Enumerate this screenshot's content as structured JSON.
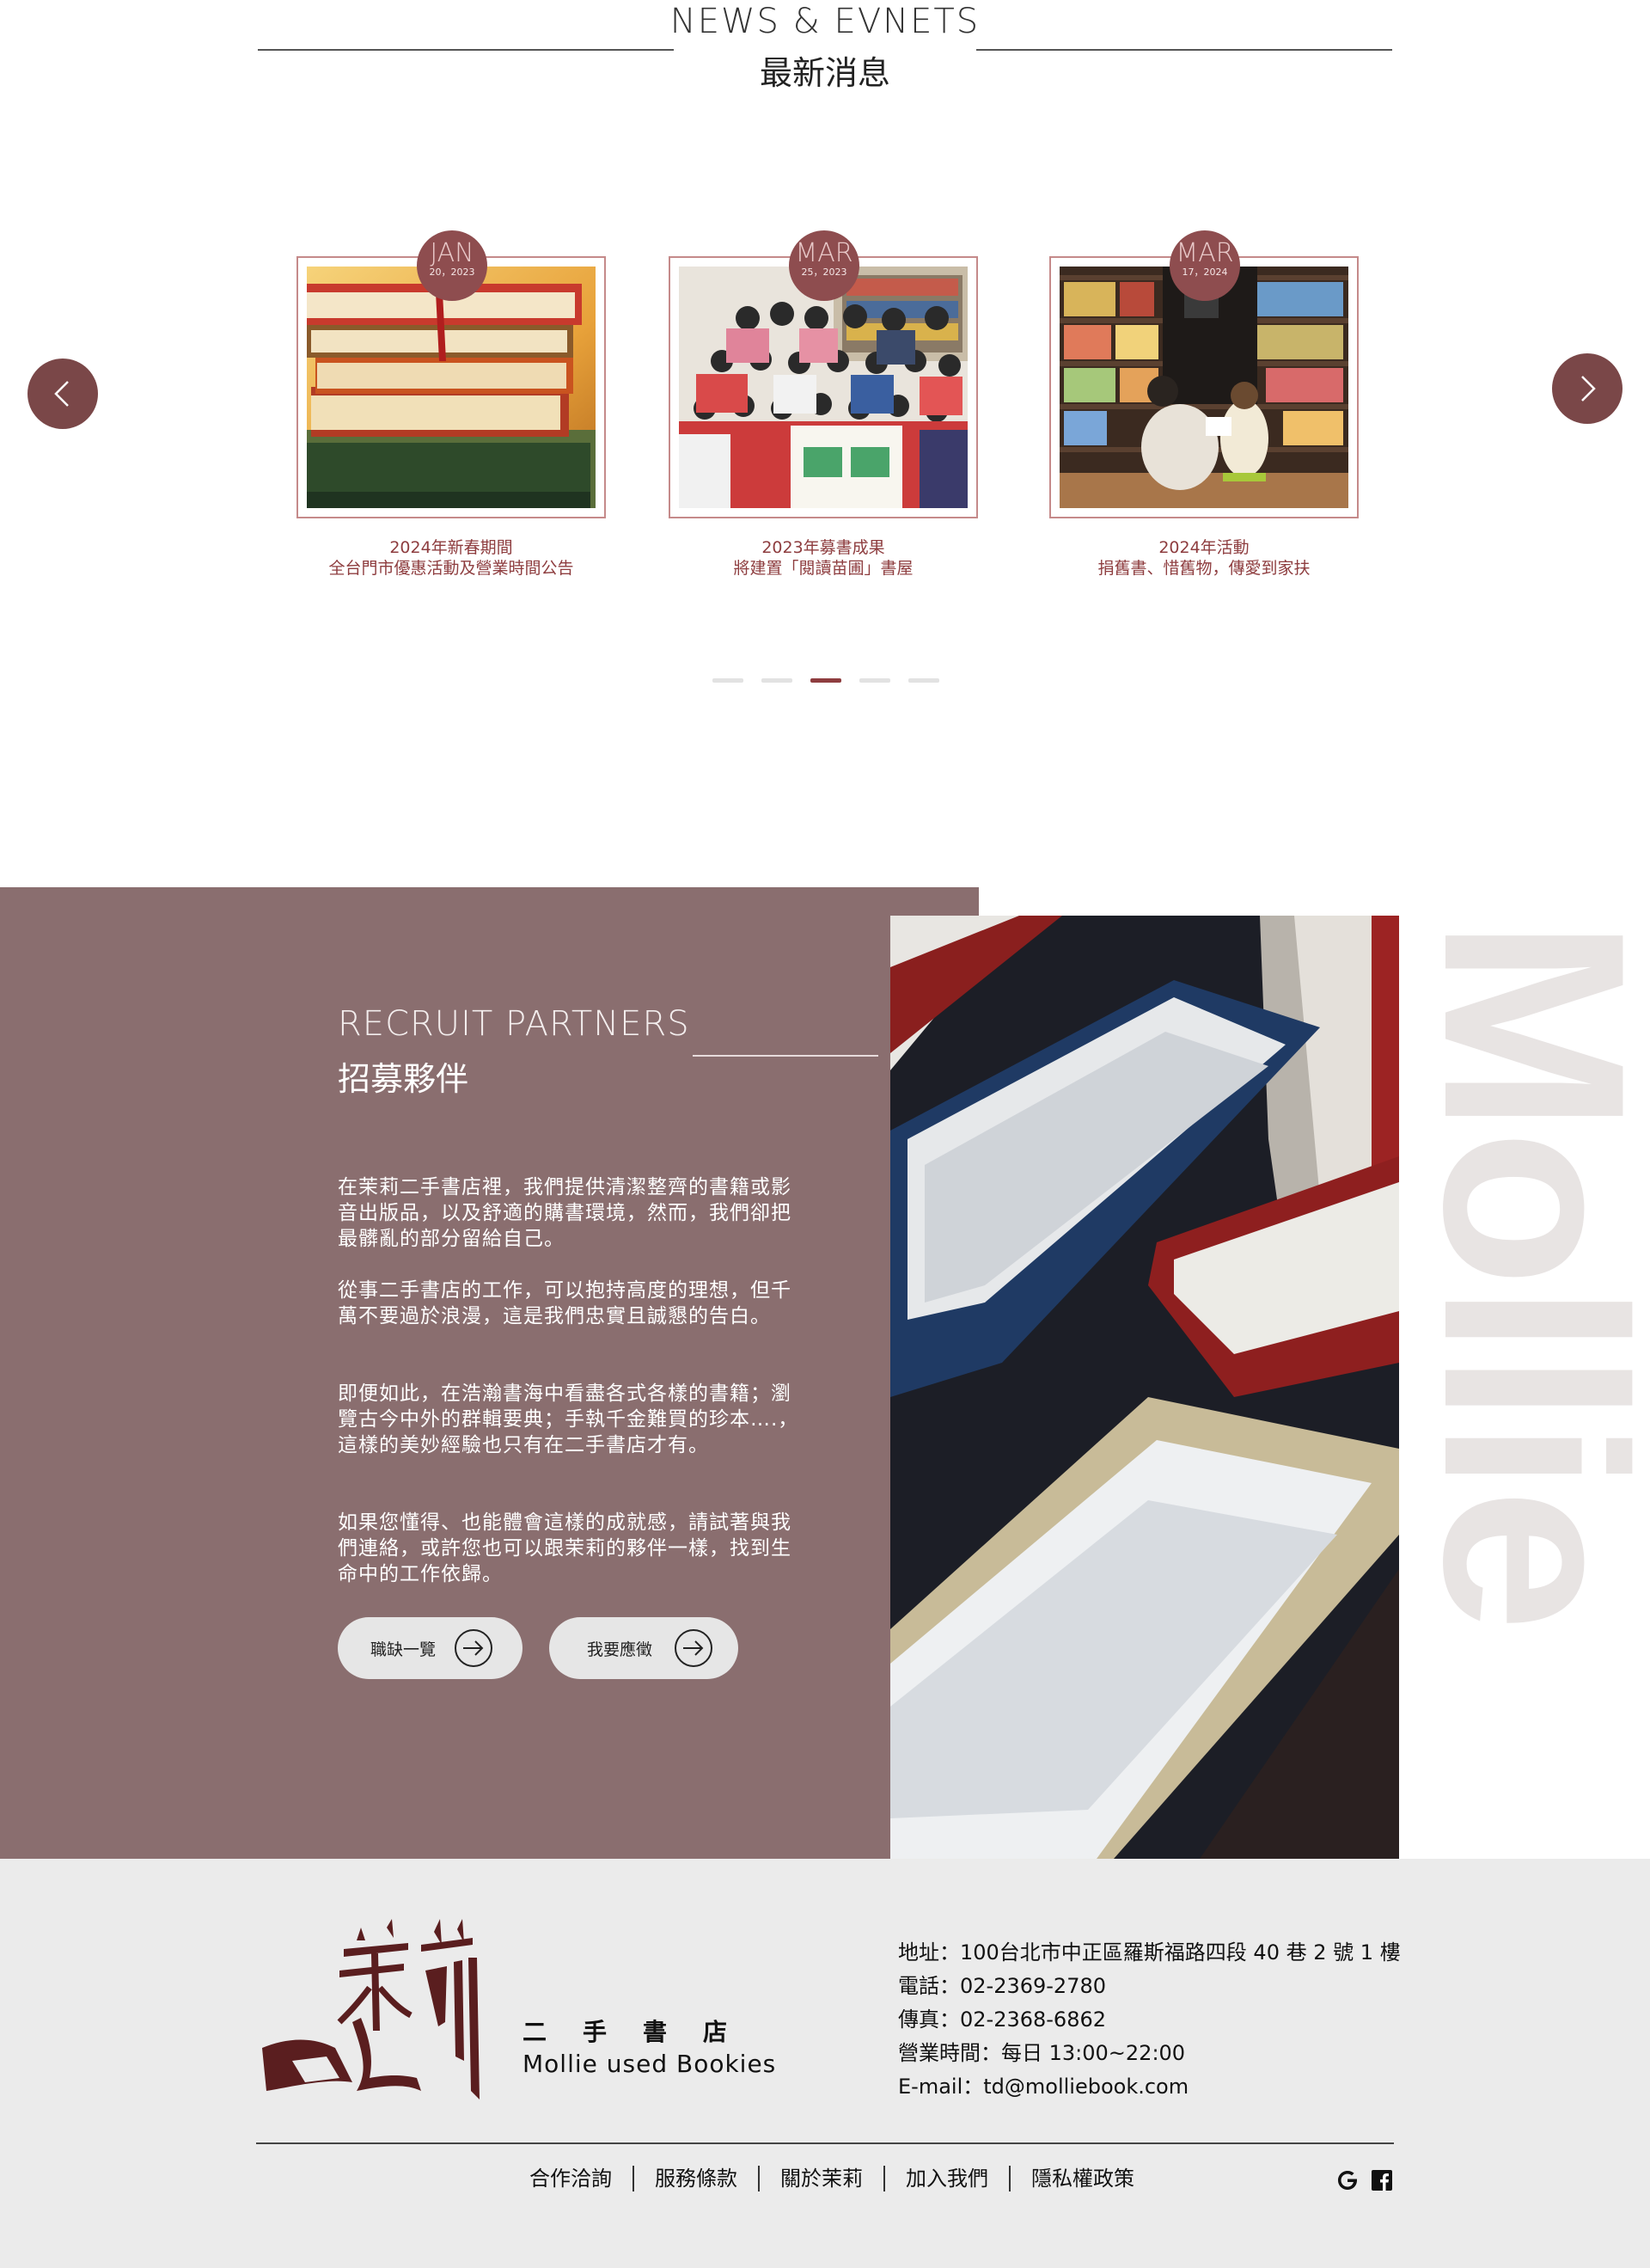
{
  "news": {
    "heading_en": "NEWS & EVNETS",
    "heading_zh": "最新消息",
    "prev_icon": "chevron-left-icon",
    "next_icon": "chevron-right-icon",
    "cards": [
      {
        "month": "JAN",
        "day": "20，2023",
        "title_line1": "2024年新春期間",
        "title_line2": "全台門市優惠活動及營業時間公告"
      },
      {
        "month": "MAR",
        "day": "25，2023",
        "title_line1": "2023年募書成果",
        "title_line2": "將建置「閱讀苗圃」書屋"
      },
      {
        "month": "MAR",
        "day": "17，2024",
        "title_line1": "2024年活動",
        "title_line2": "捐舊書、惜舊物，傳愛到家扶"
      }
    ],
    "dots_total": 5,
    "dots_active_index": 2
  },
  "recruit": {
    "heading_en": "RECRUIT PARTNERS",
    "heading_zh": "招募夥伴",
    "watermark": "Mollie",
    "paragraphs": [
      "在茉莉二手書店裡，我們提供清潔整齊的書籍或影音出版品，以及舒適的購書環境，然而，我們卻把最髒亂的部分留給自己。",
      "從事二手書店的工作，可以抱持高度的理想，但千萬不要過於浪漫，這是我們忠實且誠懇的告白。",
      "即便如此，在浩瀚書海中看盡各式各樣的書籍；瀏覽古今中外的群輯要典；手執千金難買的珍本….，這樣的美妙經驗也只有在二手書店才有。",
      "如果您懂得、也能體會這樣的成就感，請試著與我們連絡，或許您也可以跟茉莉的夥伴一樣，找到生命中的工作依歸。"
    ],
    "btn_jobs": "職缺一覽",
    "btn_apply": "我要應徵",
    "btn_icon": "arrow-right-circle-icon"
  },
  "footer": {
    "brand_zh": "二手書店",
    "brand_en": "Mollie used Bookies",
    "address": "地址：100台北市中正區羅斯福路四段 40 巷 2 號 1 樓",
    "phone": "電話：02-2369-2780",
    "fax": "傳真：02-2368-6862",
    "hours": "營業時間：每日 13:00~22:00",
    "email": "E-mail：td@molliebook.com",
    "nav": [
      "合作洽詢",
      "服務條款",
      "關於茉莉",
      "加入我們",
      "隱私權政策"
    ],
    "social_icons": [
      "google-icon",
      "facebook-icon"
    ],
    "brand_color": "#5a1e1f"
  },
  "colors": {
    "accent": "#8e3d3f",
    "recruit_bg": "#8a6e6f",
    "footer_bg": "#ebebeb",
    "arrow_bg": "#7a4748"
  }
}
